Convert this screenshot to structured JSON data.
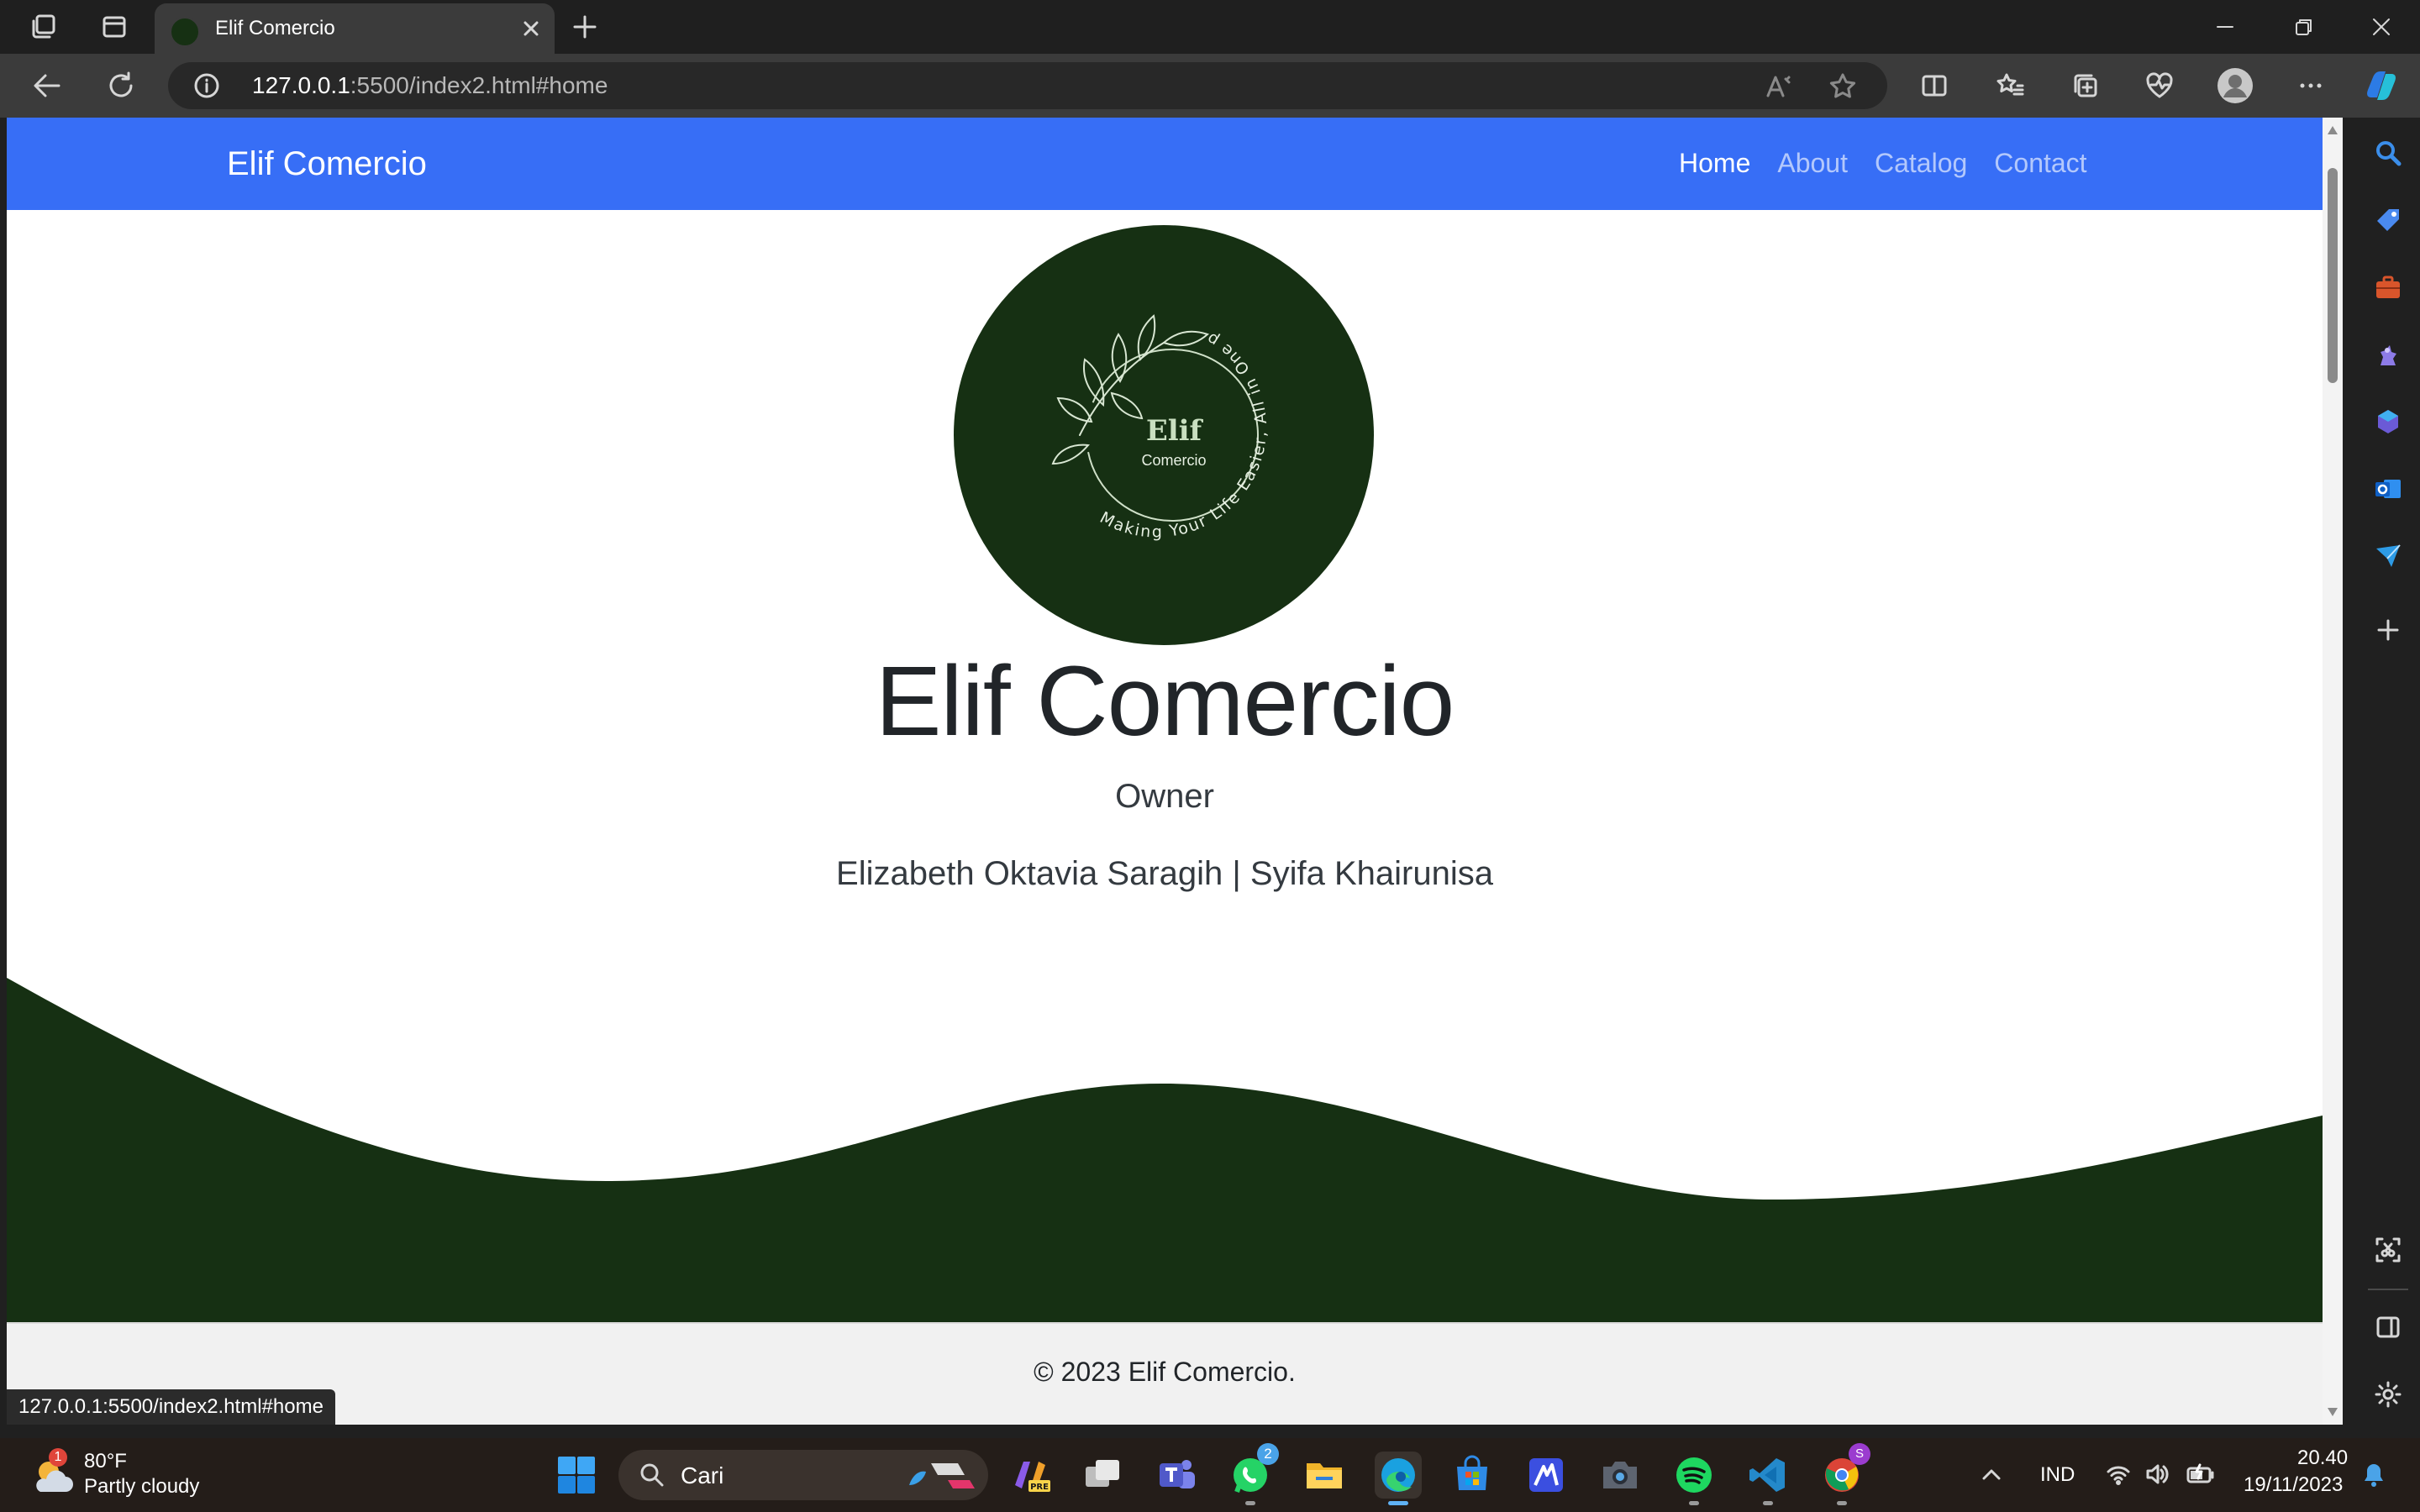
{
  "browser": {
    "tab_title": "Elif Comercio",
    "url_host": "127.0.0.1",
    "url_rest": ":5500/index2.html#home",
    "status_url": "127.0.0.1:5500/index2.html#home"
  },
  "site": {
    "brand": "Elif Comercio",
    "nav": [
      {
        "label": "Home",
        "active": true
      },
      {
        "label": "About",
        "active": false
      },
      {
        "label": "Catalog",
        "active": false
      },
      {
        "label": "Contact",
        "active": false
      }
    ],
    "logo": {
      "title": "Elif",
      "subtitle": "Comercio",
      "arc_text": "Making Your Life Easier, All in One place"
    },
    "hero": {
      "title": "Elif Comercio",
      "role": "Owner",
      "names": "Elizabeth Oktavia Saragih | Syifa Khairunisa"
    },
    "footer": "© 2023 Elif Comercio."
  },
  "taskbar": {
    "weather_temp": "80°F",
    "weather_desc": "Partly cloudy",
    "weather_badge": "1",
    "search_placeholder": "Cari",
    "whatsapp_badge": "2",
    "chrome_badge": "S",
    "language": "IND",
    "time": "20.40",
    "date": "19/11/2023"
  },
  "colors": {
    "navbar": "#376ef6",
    "brand_green": "#163013",
    "taskbar": "#241d19"
  }
}
